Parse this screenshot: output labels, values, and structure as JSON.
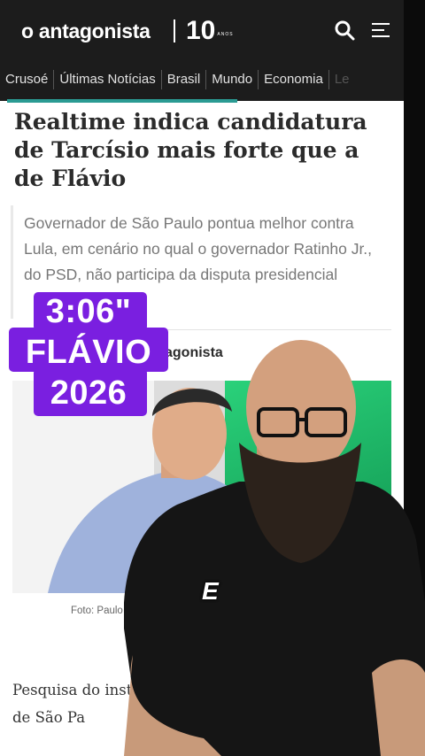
{
  "header": {
    "logo_text": "o antagonista",
    "anniversary_number": "10",
    "anniversary_label": "ANOS",
    "icons": [
      "search-icon",
      "menu-icon"
    ]
  },
  "nav": {
    "items": [
      "Crusoé",
      "Últimas Notícias",
      "Brasil",
      "Mundo",
      "Economia",
      "Le"
    ],
    "accent_color": "#2b9b93"
  },
  "article": {
    "headline": "Realtime indica candidatura de Tarcísio mais forte que a de Flávio",
    "subhead": "Governador de São Paulo pontua melhor contra Lula, em cenário no qual o governador Ratinho Jr., do PSD, não participa da disputa presidencial",
    "byline": "agonista",
    "photo_caption": "Foto: Paulo C",
    "body": "Pesquisa do insti divulgada nesta quar governador de São Pa"
  },
  "overlay": {
    "badge_lines": [
      "3:06\"",
      "FLÁVIO",
      "2026"
    ],
    "badge_color": "#7a1fe0",
    "caption_word": "E"
  }
}
